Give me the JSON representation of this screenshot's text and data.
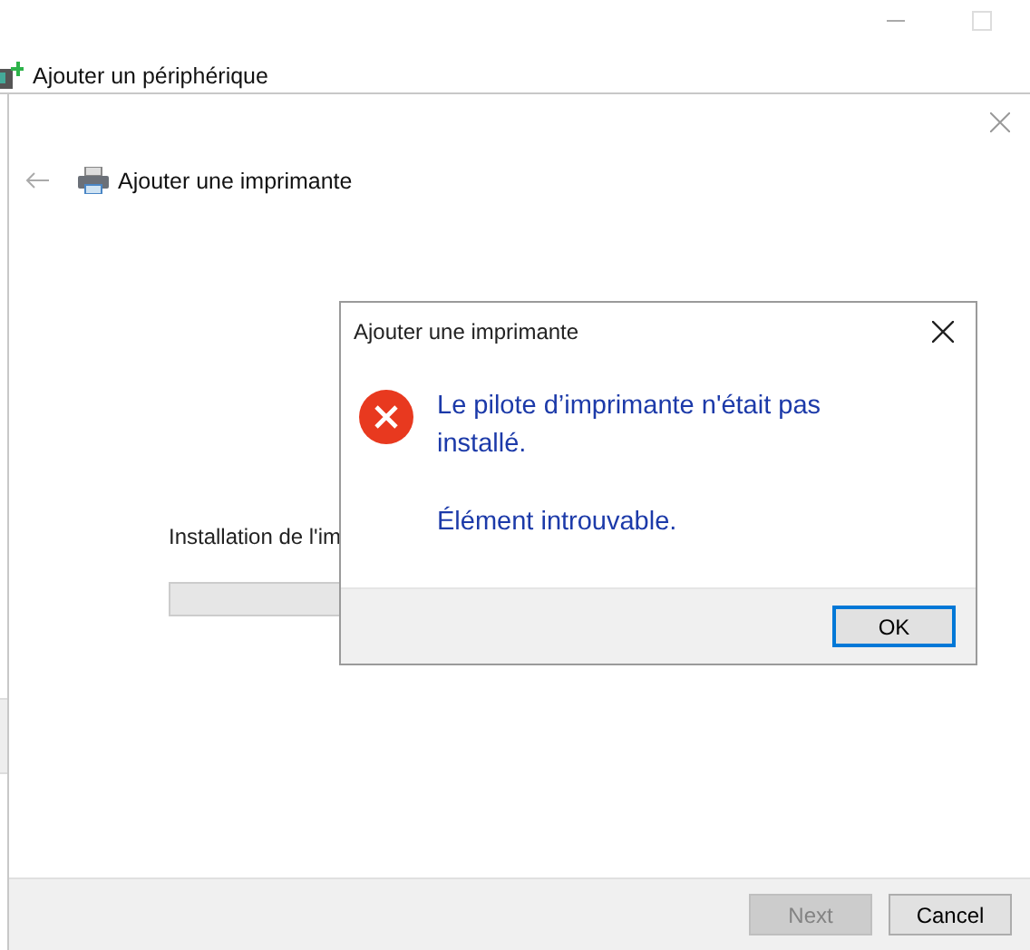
{
  "window": {
    "title": "Ajouter un périphérique"
  },
  "wizard": {
    "title": "Ajouter une imprimante",
    "status": "Installation de l'im",
    "buttons": [
      {
        "label": "Next",
        "disabled": true
      },
      {
        "label": "Cancel",
        "disabled": false
      }
    ]
  },
  "dialog": {
    "title": "Ajouter une imprimante",
    "message": "Le pilote d’imprimante n'était pas installé.",
    "detail": "Élément introuvable.",
    "buttons": [
      {
        "label": "OK",
        "focused": true
      }
    ]
  }
}
